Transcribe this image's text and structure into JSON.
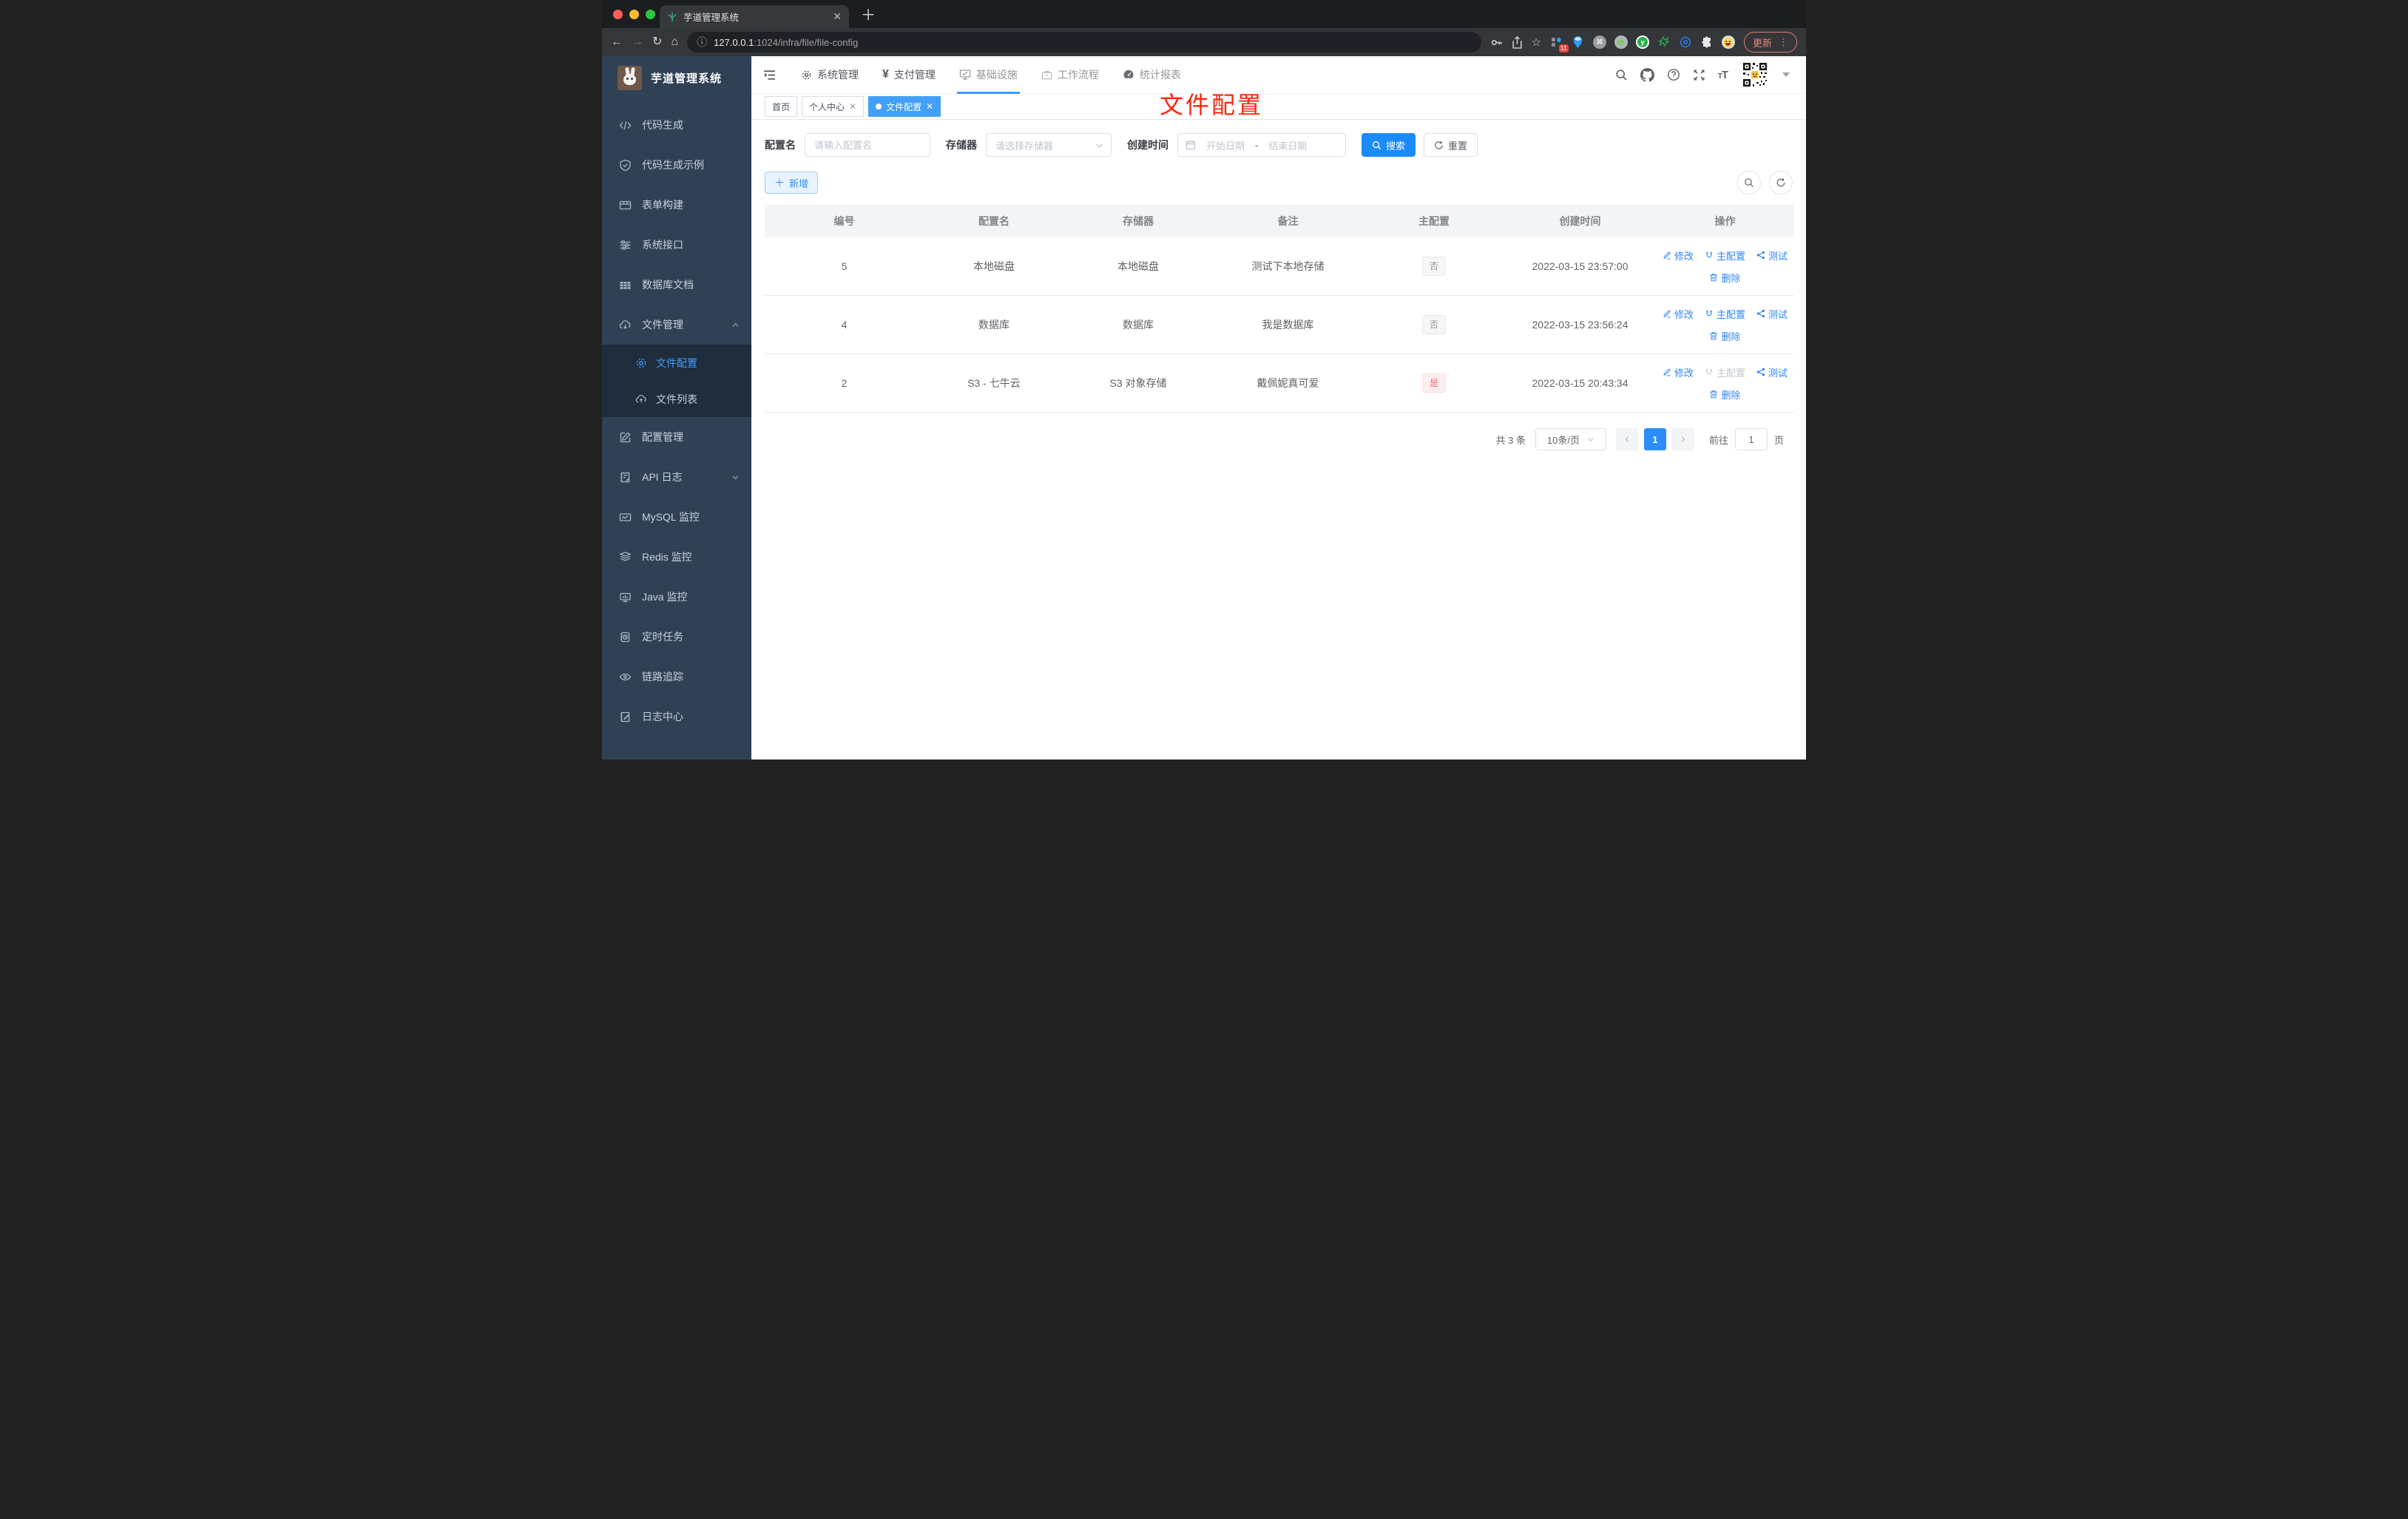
{
  "browser": {
    "tab_title": "芋道管理系统",
    "url_host": "127.0.0.1",
    "url_rest": ":1024/infra/file/file-config",
    "update_label": "更新",
    "ext_badge": "11"
  },
  "sidebar": {
    "logo_title": "芋道管理系统",
    "items": [
      {
        "label": "代码生成"
      },
      {
        "label": "代码生成示例"
      },
      {
        "label": "表单构建"
      },
      {
        "label": "系统接口"
      },
      {
        "label": "数据库文档"
      },
      {
        "label": "文件管理"
      },
      {
        "label": "文件配置"
      },
      {
        "label": "文件列表"
      },
      {
        "label": "配置管理"
      },
      {
        "label": "API 日志"
      },
      {
        "label": "MySQL 监控"
      },
      {
        "label": "Redis 监控"
      },
      {
        "label": "Java 监控"
      },
      {
        "label": "定时任务"
      },
      {
        "label": "链路追踪"
      },
      {
        "label": "日志中心"
      }
    ]
  },
  "topnav": {
    "items": [
      {
        "label": "系统管理"
      },
      {
        "label": "支付管理"
      },
      {
        "label": "基础设施"
      },
      {
        "label": "工作流程"
      },
      {
        "label": "统计报表"
      }
    ]
  },
  "tags": [
    {
      "label": "首页"
    },
    {
      "label": "个人中心"
    },
    {
      "label": "文件配置"
    }
  ],
  "annotation": "文件配置",
  "filters": {
    "name_label": "配置名",
    "name_placeholder": "请输入配置名",
    "storage_label": "存储器",
    "storage_placeholder": "请选择存储器",
    "date_label": "创建时间",
    "date_start": "开始日期",
    "date_sep": "-",
    "date_end": "结束日期",
    "search_label": "搜索",
    "reset_label": "重置"
  },
  "toolbar": {
    "add_label": "新增"
  },
  "table": {
    "columns": [
      "编号",
      "配置名",
      "存储器",
      "备注",
      "主配置",
      "创建时间",
      "操作"
    ],
    "actions": {
      "edit": "修改",
      "master": "主配置",
      "test": "测试",
      "del": "删除"
    },
    "rows": [
      {
        "id": "5",
        "name": "本地磁盘",
        "storage": "本地磁盘",
        "remark": "测试下本地存储",
        "master": "否",
        "created": "2022-03-15 23:57:00"
      },
      {
        "id": "4",
        "name": "数据库",
        "storage": "数据库",
        "remark": "我是数据库",
        "master": "否",
        "created": "2022-03-15 23:56:24"
      },
      {
        "id": "2",
        "name": "S3 - 七牛云",
        "storage": "S3 对象存储",
        "remark": "戴佩妮真可爱",
        "master": "是",
        "created": "2022-03-15 20:43:34"
      }
    ]
  },
  "pagination": {
    "total": "共 3 条",
    "page_size": "10条/页",
    "current": "1",
    "goto": "前往",
    "goto_value": "1",
    "unit": "页"
  },
  "colors": {
    "primary": "#409eff",
    "sidebar_bg": "#304156",
    "submenu_bg": "#1f2d3d",
    "danger": "#f56c6c",
    "annotation_red": "#f9270e"
  }
}
